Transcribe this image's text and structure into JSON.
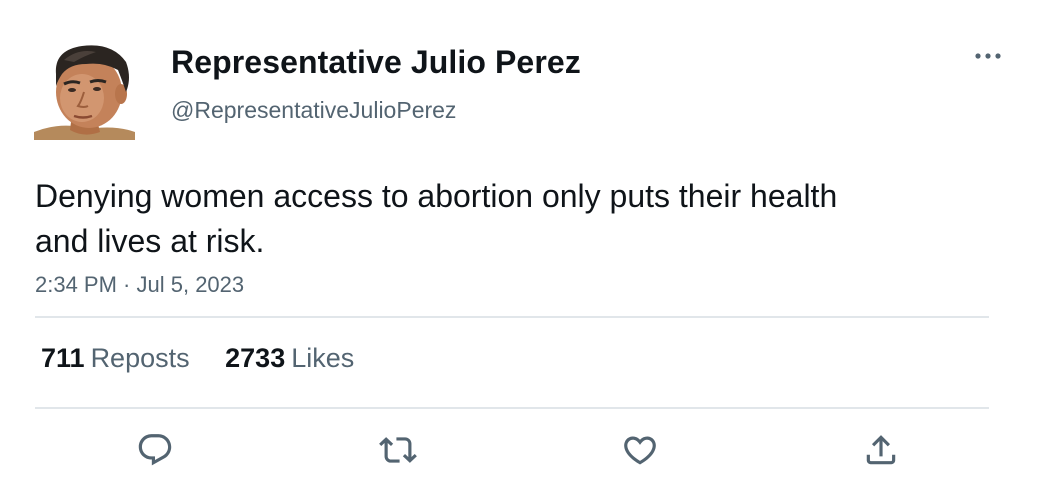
{
  "author": {
    "name": "Representative Julio Perez",
    "handle": "@RepresentativeJulioPerez",
    "avatar": "profile-photo"
  },
  "tweet": {
    "text": "Denying women access to abortion only puts their health and lives at risk.",
    "time": "2:34 PM",
    "separator": " · ",
    "date": "Jul 5, 2023"
  },
  "stats": {
    "reposts_count": "711",
    "reposts_label": "Reposts",
    "likes_count": "2733",
    "likes_label": "Likes"
  },
  "icons": {
    "more": "more-horizontal-icon",
    "reply": "reply-icon",
    "repost": "repost-icon",
    "like": "heart-icon",
    "share": "share-icon"
  },
  "colors": {
    "text_primary": "#0f1419",
    "text_secondary": "#536471",
    "divider": "#e1e6ea",
    "icon": "#536471"
  }
}
